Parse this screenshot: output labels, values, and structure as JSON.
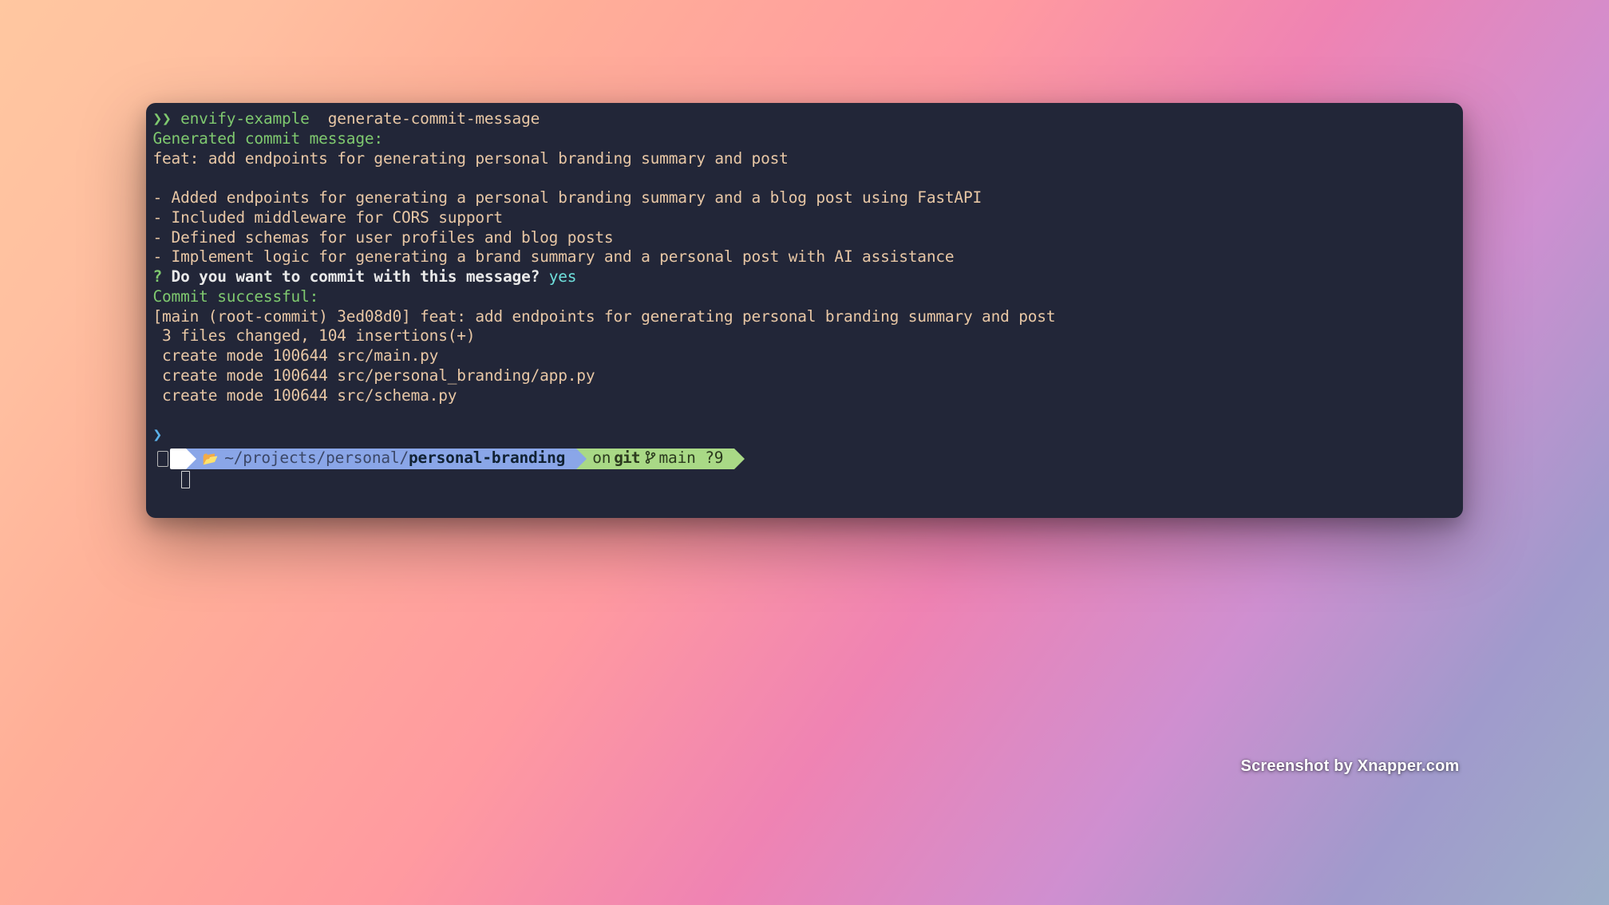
{
  "cmd": {
    "leading_symbol": "❯",
    "tool": "envify-example",
    "command": "generate-commit-message"
  },
  "output": {
    "header": "Generated commit message:",
    "title": "feat: add endpoints for generating personal branding summary and post",
    "bullets": [
      "- Added endpoints for generating a personal branding summary and a blog post using FastAPI",
      "- Included middleware for CORS support",
      "- Defined schemas for user profiles and blog posts",
      "- Implement logic for generating a brand summary and a personal post with AI assistance"
    ],
    "prompt_qmark": "?",
    "prompt_question": "Do you want to commit with this message?",
    "prompt_answer": "yes",
    "success_header": "Commit successful:",
    "commit_lines": [
      "[main (root-commit) 3ed08d0] feat: add endpoints for generating personal branding summary and post",
      " 3 files changed, 104 insertions(+)",
      " create mode 100644 src/main.py",
      " create mode 100644 src/personal_branding/app.py",
      " create mode 100644 src/schema.py"
    ]
  },
  "prompt_line_marker": "❯",
  "powerline": {
    "apple_icon": "",
    "folder_icon": "📂",
    "path_prefix": "~/projects/personal/",
    "path_bold": "personal-branding",
    "git_prefix": "on",
    "git_word": "git",
    "branch": "main",
    "dirty": "?9"
  },
  "watermark": "Screenshot by Xnapper.com"
}
